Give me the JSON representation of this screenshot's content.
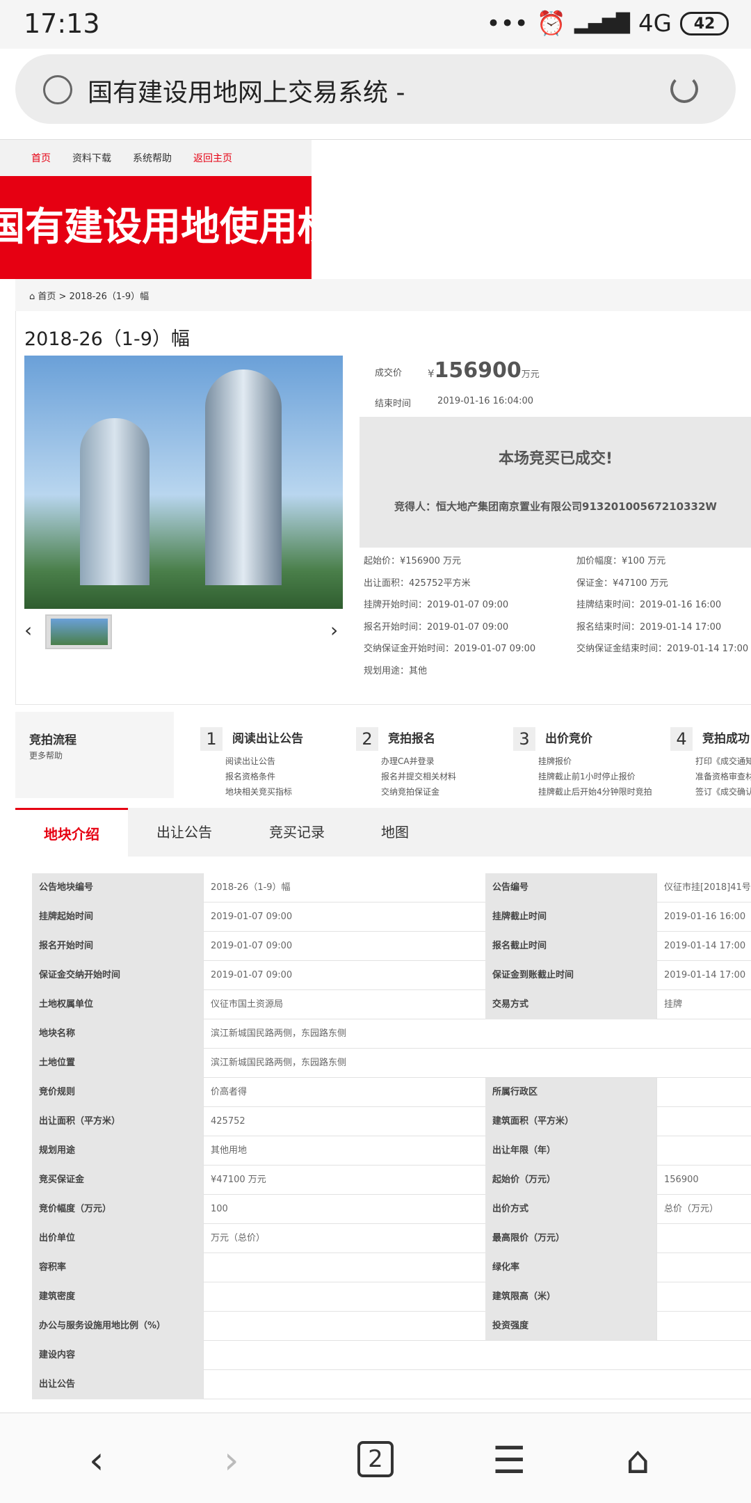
{
  "status": {
    "time": "17:13",
    "dots": "•••",
    "alarm": "⏰",
    "network": "4G",
    "battery": "42"
  },
  "browser": {
    "title": "国有建设用地网上交易系统 -"
  },
  "site": {
    "nav": [
      "首页",
      "资料下载",
      "系统帮助",
      "返回主页"
    ],
    "banner": "国有建设用地使用权",
    "breadcrumb": {
      "home": "首页",
      "sep": ">",
      "current": "2018-26（1-9）幅"
    },
    "lot_title": "2018-26（1-9）幅",
    "deal": {
      "price_label": "成交价",
      "yen": "¥",
      "price": "156900",
      "unit": "万元",
      "end_label": "结束时间",
      "end_time": "2019-01-16 16:04:00"
    },
    "result": {
      "msg": "本场竞买已成交!",
      "winner": "竞得人：恒大地产集团南京置业有限公司91320100567210332W"
    },
    "details": [
      {
        "l": "起始价：¥156900 万元",
        "r": "加价幅度：¥100 万元"
      },
      {
        "l": "出让面积：425752平方米",
        "r": "保证金：¥47100 万元"
      },
      {
        "l": "挂牌开始时间：2019-01-07 09:00",
        "r": "挂牌结束时间：2019-01-16 16:00"
      },
      {
        "l": "报名开始时间：2019-01-07 09:00",
        "r": "报名结束时间：2019-01-14 17:00"
      },
      {
        "l": "交纳保证金开始时间：2019-01-07 09:00",
        "r": "交纳保证金结束时间：2019-01-14 17:00"
      },
      {
        "l": "规划用途：其他",
        "r": ""
      }
    ],
    "process": {
      "title": "竞拍流程",
      "more": "更多帮助",
      "steps": [
        {
          "n": "1",
          "t": "阅读出让公告",
          "s": [
            "阅读出让公告",
            "报名资格条件",
            "地块相关竞买指标"
          ]
        },
        {
          "n": "2",
          "t": "竞拍报名",
          "s": [
            "办理CA并登录",
            "报名并提交相关材料",
            "交纳竞拍保证金"
          ]
        },
        {
          "n": "3",
          "t": "出价竞价",
          "s": [
            "挂牌报价",
            "挂牌截止前1小时停止报价",
            "挂牌截止后开始4分钟限时竞拍"
          ]
        },
        {
          "n": "4",
          "t": "竞拍成功",
          "s": [
            "打印《成交通知书",
            "准备资格审查材料",
            "签订《成交确认书"
          ]
        }
      ]
    },
    "tabs": [
      "地块介绍",
      "出让公告",
      "竞买记录",
      "地图"
    ],
    "table": [
      [
        "公告地块编号",
        "2018-26（1-9）幅",
        "公告编号",
        "仪征市挂[2018]41号"
      ],
      [
        "挂牌起始时间",
        "2019-01-07 09:00",
        "挂牌截止时间",
        "2019-01-16 16:00"
      ],
      [
        "报名开始时间",
        "2019-01-07 09:00",
        "报名截止时间",
        "2019-01-14 17:00"
      ],
      [
        "保证金交纳开始时间",
        "2019-01-07 09:00",
        "保证金到账截止时间",
        "2019-01-14 17:00"
      ],
      [
        "土地权属单位",
        "仪征市国土资源局",
        "交易方式",
        "挂牌"
      ],
      [
        "地块名称",
        "滨江新城国民路两侧，东园路东侧"
      ],
      [
        "土地位置",
        "滨江新城国民路两侧，东园路东侧"
      ],
      [
        "竞价规则",
        "价高者得",
        "所属行政区",
        ""
      ],
      [
        "出让面积（平方米）",
        "425752",
        "建筑面积（平方米）",
        ""
      ],
      [
        "规划用途",
        "其他用地",
        "出让年限（年）",
        ""
      ],
      [
        "竞买保证金",
        "¥47100 万元",
        "起始价（万元）",
        "156900"
      ],
      [
        "竞价幅度（万元）",
        "100",
        "出价方式",
        "总价（万元）"
      ],
      [
        "出价单位",
        "万元（总价）",
        "最高限价（万元）",
        ""
      ],
      [
        "容积率",
        "",
        "绿化率",
        ""
      ],
      [
        "建筑密度",
        "",
        "建筑限高（米）",
        ""
      ],
      [
        "办公与服务设施用地比例（%）",
        "",
        "投资强度",
        ""
      ],
      [
        "建设内容",
        ""
      ],
      [
        "出让公告",
        ""
      ]
    ]
  },
  "bottom": {
    "back": "‹",
    "forward": "›",
    "tabs": "2",
    "menu": "☰"
  }
}
